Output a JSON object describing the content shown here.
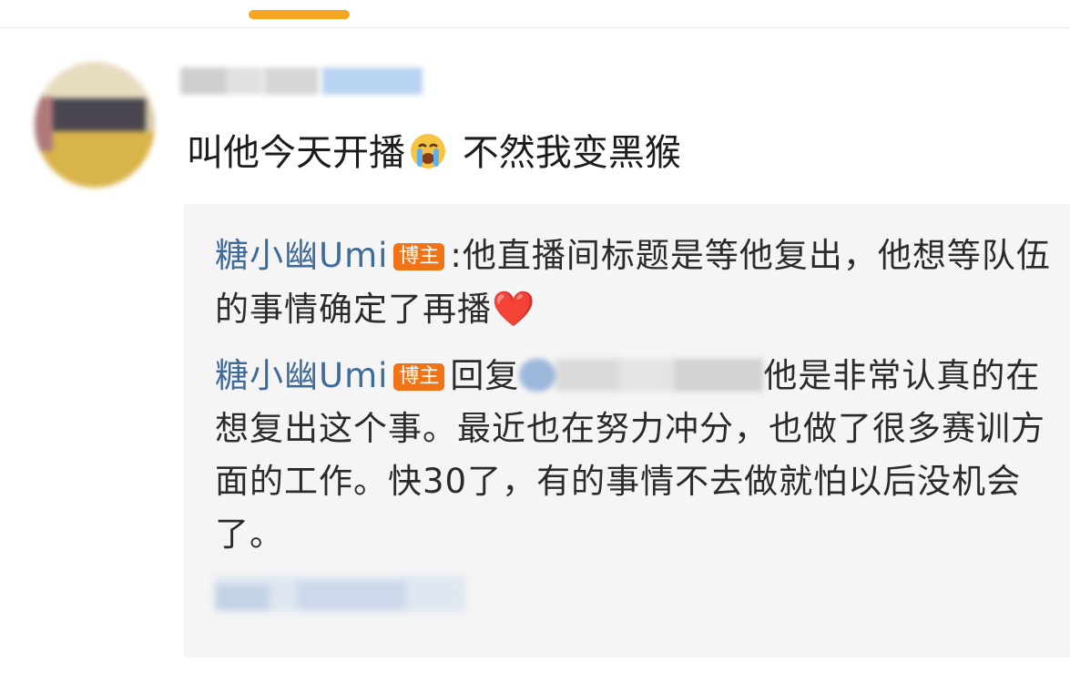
{
  "comment": {
    "text_before": "叫他今天开播",
    "emoji": "crying-face",
    "text_after": " 不然我变黑猴"
  },
  "replies": [
    {
      "author": "糖小幽Umi",
      "badge": "博主",
      "separator": ":",
      "text": "他直播间标题是等他复出，他想等队伍的事情确定了再播",
      "emoji": "❤️"
    },
    {
      "author": "糖小幽Umi",
      "badge": "博主",
      "reply_prefix": "回复",
      "text": "他是非常认真的在想复出这个事。最近也在努力冲分，也做了很多赛训方面的工作。快30了，有的事情不去做就怕以后没机会了。"
    }
  ],
  "colors": {
    "accent": "#f5a623",
    "author": "#3f6b9a",
    "badge": "#f07318",
    "reply_bg": "#f5f5f5"
  }
}
